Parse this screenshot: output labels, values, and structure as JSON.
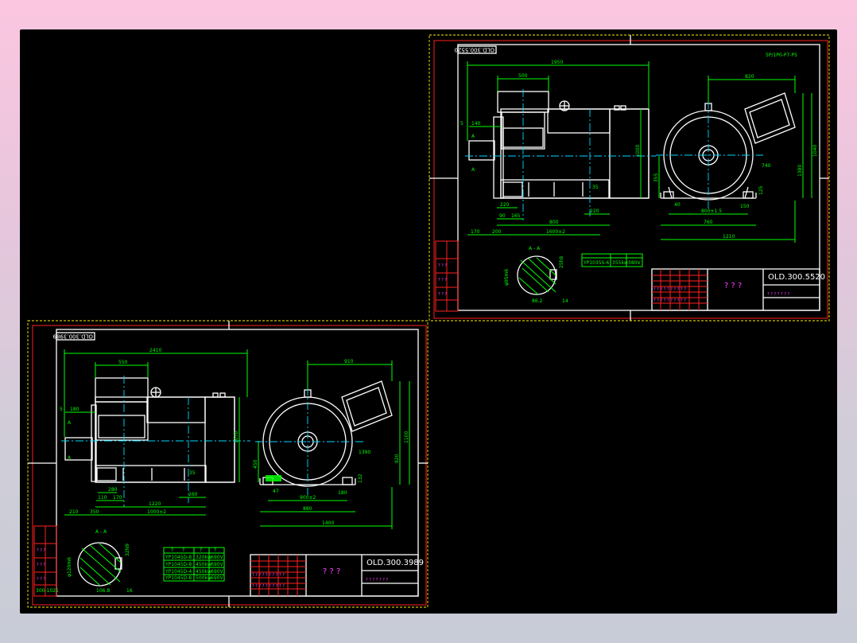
{
  "drawing_right": {
    "code_stamp": "OLD.300.5520",
    "title_code": "OLD.300.5520",
    "title_name": "? ? ?",
    "section_label": "A - A",
    "view_mark": "A",
    "spec_rows": [
      [
        "YP1035S-6",
        "355kw",
        "380V"
      ]
    ],
    "dims": {
      "overall": "1950",
      "box": "500",
      "top_off": "140",
      "edge": "5",
      "h1": "1000",
      "h2": "355",
      "bolt_l": "220",
      "bolt_c": "90",
      "bolt_s": "165",
      "body": "800",
      "foot_r": "220",
      "base_l": "170",
      "base_c": "200",
      "base_t": "1600±2",
      "term_r": "35",
      "tb_w": "820",
      "a": "740",
      "h3": "1380",
      "h4": "1040",
      "foot_h": "125",
      "f1": "40",
      "fc": "800±1.5",
      "fd": "150",
      "fw": "760",
      "total_w": "1210",
      "shaft_d": "φ95m6",
      "key": "25h8",
      "shaft_l": "86.2",
      "key_w": "14",
      "top_note": "5P/1P0-P7-P5"
    }
  },
  "drawing_left": {
    "code_stamp": "OLD.300.3989",
    "title_code": "OLD.300.3989",
    "title_name": "? ? ?",
    "section_label": "A - A",
    "view_mark": "A",
    "spec_rows": [
      [
        "?",
        "?",
        "?",
        "?"
      ],
      [
        "YP1045D-8",
        "320kw",
        "690V"
      ],
      [
        "YP1045D-8",
        "450kw",
        "690V"
      ],
      [
        "YP1045D-4",
        "450kw",
        "690V"
      ],
      [
        "YP1045D-8",
        "500kw",
        "690V"
      ]
    ],
    "dims": {
      "overall": "2410",
      "box": "550",
      "top_off": "180",
      "edge": "5",
      "h1": "1070",
      "h2": "450",
      "bolt_l": "280",
      "bolt_c": "110",
      "bolt_s": "170",
      "body": "1220",
      "foot_r": "260",
      "base_l": "210",
      "base_c": "350",
      "base_t": "1000±2",
      "term_r": "35",
      "tb_w": "910",
      "a": "1390",
      "h3": "1100",
      "h4": "920",
      "foot_h": "132",
      "f1": "47",
      "fc": "900±2",
      "fd": "180",
      "fw": "880",
      "total_w": "1400",
      "shaft_d": "φ120m6",
      "key": "32N9",
      "shaft_l": "106.8",
      "key_w": "16",
      "side_note": "300-1021"
    }
  }
}
